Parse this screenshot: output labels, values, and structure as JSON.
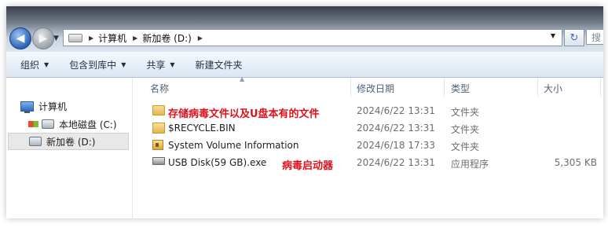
{
  "address": {
    "crumbs": [
      "计算机",
      "新加卷 (D:)"
    ],
    "search_placeholder": "搜"
  },
  "toolbar": {
    "organize": "组织",
    "include_in_library": "包含到库中",
    "share": "共享",
    "new_folder": "新建文件夹"
  },
  "nav": {
    "computer": "计算机",
    "local_disk": "本地磁盘 (C:)",
    "new_volume": "新加卷 (D:)"
  },
  "columns": {
    "name": "名称",
    "date": "修改日期",
    "type": "类型",
    "size": "大小"
  },
  "files": [
    {
      "name": "存储病毒文件以及U盘本有的文件",
      "date": "2024/6/22 13:31",
      "type": "文件夹",
      "size": "",
      "icon": "folder-icon"
    },
    {
      "name": "$RECYCLE.BIN",
      "date": "2024/6/22 13:31",
      "type": "文件夹",
      "size": "",
      "icon": "folder-icon"
    },
    {
      "name": "System Volume Information",
      "date": "2024/6/18 17:33",
      "type": "文件夹",
      "size": "",
      "icon": "locked-folder-icon"
    },
    {
      "name": "USB Disk(59 GB).exe",
      "date": "2024/6/22 13:31",
      "type": "应用程序",
      "size": "5,305 KB",
      "icon": "drive-exe-icon"
    }
  ],
  "annotations": {
    "virus_launcher": "病毒启动器"
  },
  "colors": {
    "annotation": "#e0101a",
    "selection": "#e8e8e8",
    "toolbar_text": "#1e2f45"
  }
}
